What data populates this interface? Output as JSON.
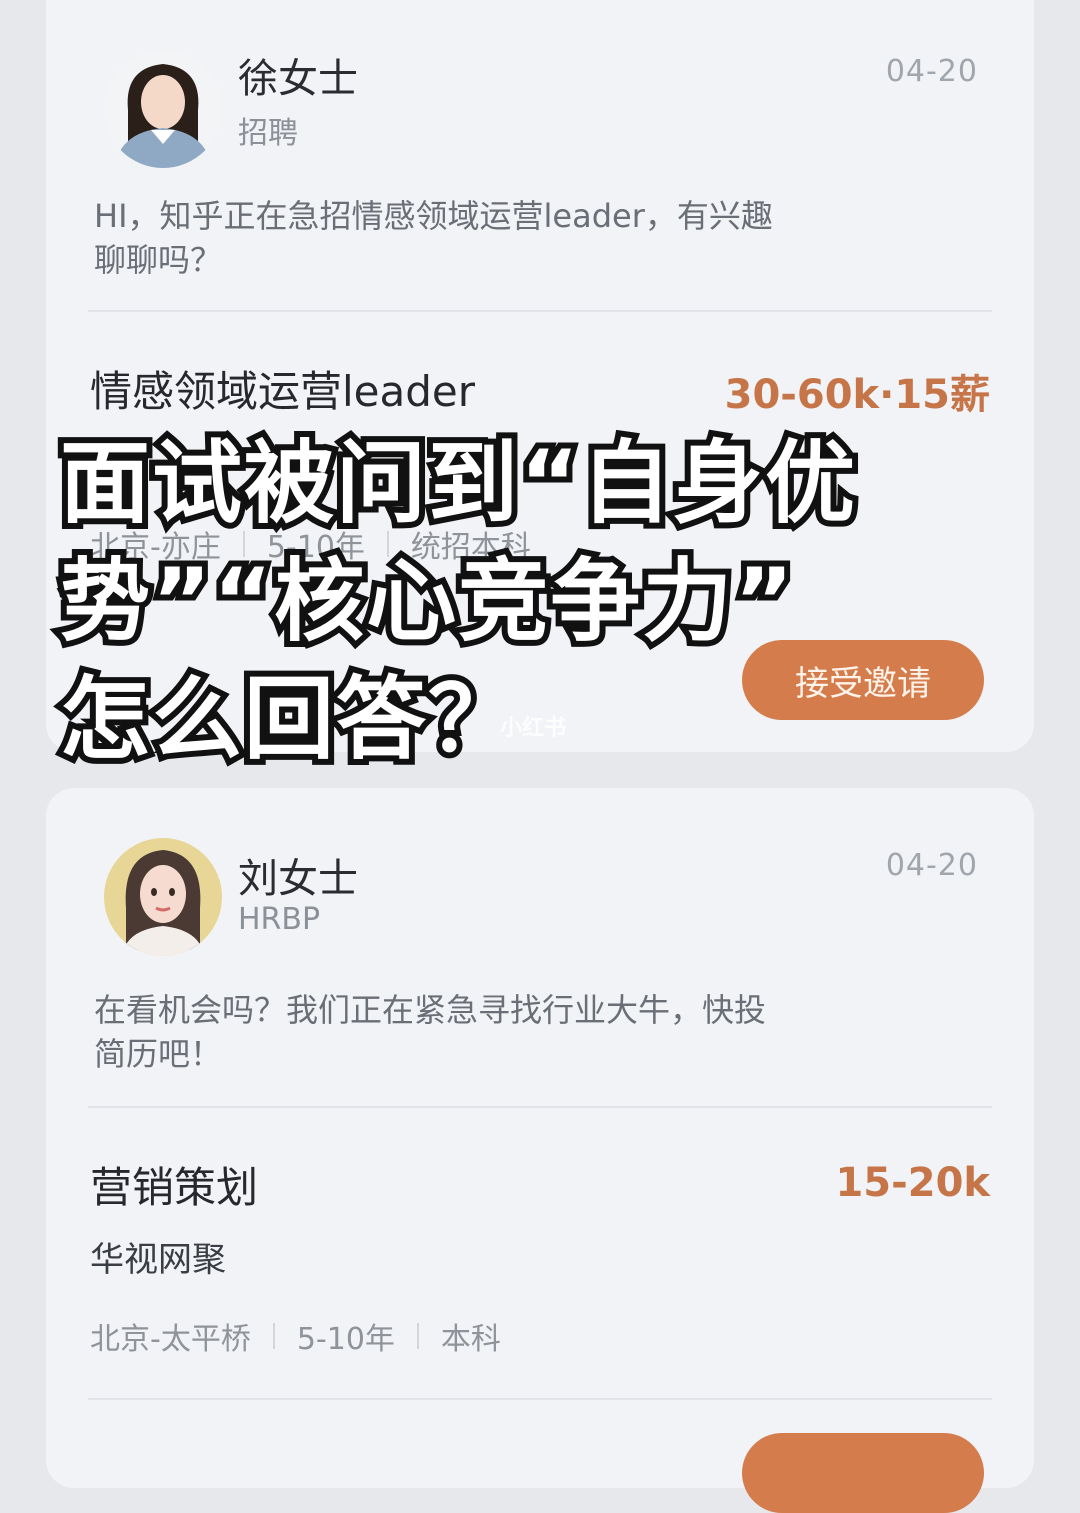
{
  "cards": [
    {
      "name": "徐女士",
      "role": "招聘",
      "date": "04-20",
      "message_line1": "HI，知乎正在急招情感领域运营leader，有兴趣",
      "message_line2": "聊聊吗？",
      "job_title": "情感领域运营leader",
      "salary": "30-60k·15薪",
      "meta": [
        "北京-亦庄",
        "5-10年",
        "统招本科"
      ],
      "accept_label": "接受邀请"
    },
    {
      "name": "刘女士",
      "role": "HRBP",
      "date": "04-20",
      "message_line1": "在看机会吗？我们正在紧急寻找行业大牛，快投",
      "message_line2": "简历吧！",
      "job_title": "营销策划",
      "salary": "15-20k",
      "company": "华视网聚",
      "meta": [
        "北京-太平桥",
        "5-10年",
        "本科"
      ]
    }
  ],
  "overlay": {
    "line1": "面试被问到“自身优",
    "line2": "势”“核心竞争力”",
    "line3": "怎么回答？"
  },
  "watermark": "小红书",
  "colors": {
    "accent": "#d47c4c",
    "salary": "#c57548",
    "background": "#e6e8ec",
    "card": "#f1f3f6"
  }
}
